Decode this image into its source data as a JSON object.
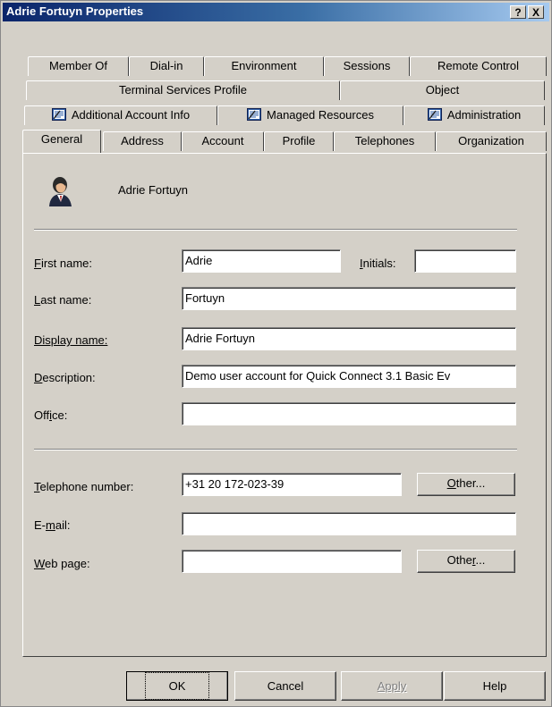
{
  "window": {
    "title": "Adrie Fortuyn Properties",
    "help_btn": "?",
    "close_btn": "X"
  },
  "tabs": {
    "row1": [
      "Member Of",
      "Dial-in",
      "Environment",
      "Sessions",
      "Remote Control"
    ],
    "row2": [
      "Terminal Services Profile",
      "Object"
    ],
    "row3": [
      "Additional Account Info",
      "Managed Resources",
      "Administration"
    ],
    "row4": [
      "General",
      "Address",
      "Account",
      "Profile",
      "Telephones",
      "Organization"
    ],
    "active": "General"
  },
  "general": {
    "user_display": "Adrie Fortuyn",
    "labels": {
      "first_name": "First name:",
      "initials": "Initials:",
      "last_name": "Last name:",
      "display_name": "Display name:",
      "description": "Description:",
      "office": "Office:",
      "telephone": "Telephone number:",
      "email": "E-mail:",
      "web_page": "Web page:"
    },
    "values": {
      "first_name": "Adrie",
      "initials": "",
      "last_name": "Fortuyn",
      "display_name": "Adrie Fortuyn",
      "description": "Demo user account for Quick Connect 3.1 Basic Ev",
      "office": "",
      "telephone": "+31 20 172-023-39",
      "email": "",
      "web_page": ""
    },
    "other_btn": "Other...",
    "other_btn2": "Other..."
  },
  "buttons": {
    "ok": "OK",
    "cancel": "Cancel",
    "apply": "Apply",
    "help": "Help"
  },
  "icons": {
    "tab_icon": "admin-sheet-icon",
    "user": "user-avatar-icon"
  }
}
